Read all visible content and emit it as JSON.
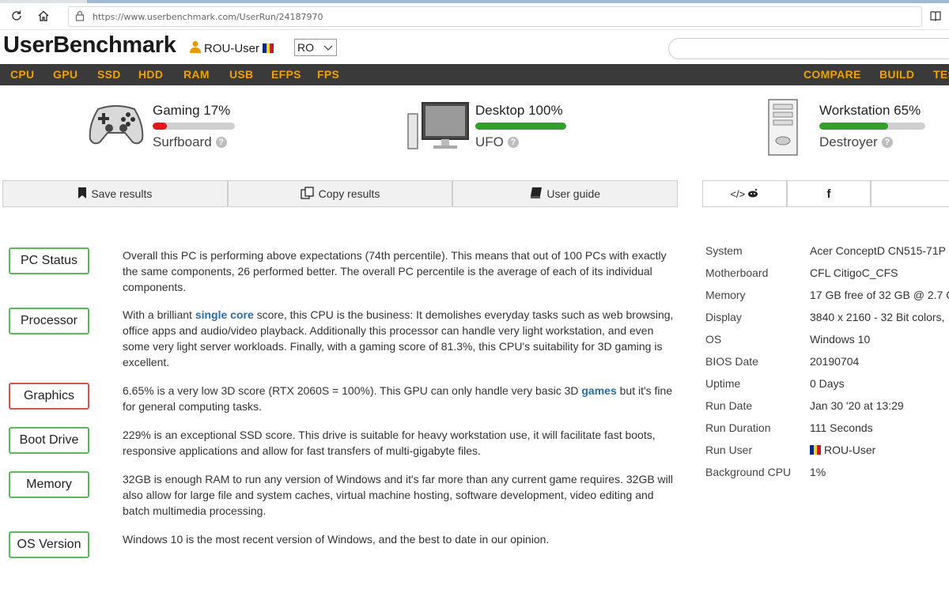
{
  "browser": {
    "url": "https://www.userbenchmark.com/UserRun/24187970"
  },
  "header": {
    "logo": "UserBenchmark",
    "username": "ROU-User",
    "language": "RO"
  },
  "menu": {
    "left": [
      "CPU",
      "GPU",
      "SSD",
      "HDD",
      "RAM",
      "USB",
      "EFPS",
      "FPS"
    ],
    "right": [
      "COMPARE",
      "BUILD",
      "TES"
    ]
  },
  "scores": [
    {
      "title": "Gaming 17%",
      "value": 17,
      "color": "#e8141c",
      "name": "Surfboard",
      "icon": "gamepad-icon"
    },
    {
      "title": "Desktop 100%",
      "value": 100,
      "color": "#33a02c",
      "name": "UFO",
      "icon": "desktop-computer-icon"
    },
    {
      "title": "Workstation 65%",
      "value": 65,
      "color": "#33a02c",
      "name": "Destroyer",
      "icon": "workstation-tower-icon"
    }
  ],
  "actions": {
    "save": "Save results",
    "copy": "Copy results",
    "guide": "User guide"
  },
  "share": {
    "embed": "</>",
    "facebook": "f"
  },
  "status": {
    "pc": {
      "label": "PC Status",
      "text": "Overall this PC is performing above expectations (74th percentile). This means that out of 100 PCs with exactly the same components, 26 performed better. The overall PC percentile is the average of each of its individual components."
    },
    "processor": {
      "label": "Processor",
      "pre": "With a brilliant ",
      "link": "single core",
      "post": " score, this CPU is the business: It demolishes everyday tasks such as web browsing, office apps and audio/video playback. Additionally this processor can handle very light workstation, and even some very light server workloads. Finally, with a gaming score of 81.3%, this CPU's suitability for 3D gaming is excellent."
    },
    "graphics": {
      "label": "Graphics",
      "pre": "6.65% is a very low 3D score (RTX 2060S = 100%). This GPU can only handle very basic 3D ",
      "link": "games",
      "post": " but it's fine for general computing tasks."
    },
    "boot": {
      "label": "Boot Drive",
      "text": "229% is an exceptional SSD score. This drive is suitable for heavy workstation use, it will facilitate fast boots, responsive applications and allow for fast transfers of multi-gigabyte files."
    },
    "memory": {
      "label": "Memory",
      "text": "32GB is enough RAM to run any version of Windows and it's far more than any current game requires. 32GB will also allow for large file and system caches, virtual machine hosting, software development, video editing and batch multimedia processing."
    },
    "os": {
      "label": "OS Version",
      "text": "Windows 10 is the most recent version of Windows, and the best to date in our opinion."
    }
  },
  "system": [
    {
      "label": "System",
      "value": "Acer ConceptD CN515-71P"
    },
    {
      "label": "Motherboard",
      "value": "CFL CitigoC_CFS"
    },
    {
      "label": "Memory",
      "value": "17 GB free of 32 GB @ 2.7 G"
    },
    {
      "label": "Display",
      "value": "3840 x 2160 - 32 Bit colors,"
    },
    {
      "label": "OS",
      "value": "Windows 10"
    },
    {
      "label": "BIOS Date",
      "value": "20190704"
    },
    {
      "label": "Uptime",
      "value": "0 Days"
    },
    {
      "label": "Run Date",
      "value": "Jan 30 '20 at 13:29"
    },
    {
      "label": "Run Duration",
      "value": "111 Seconds"
    },
    {
      "label": "Run User",
      "value": "ROU-User"
    },
    {
      "label": "Background CPU",
      "value": "1%"
    }
  ]
}
